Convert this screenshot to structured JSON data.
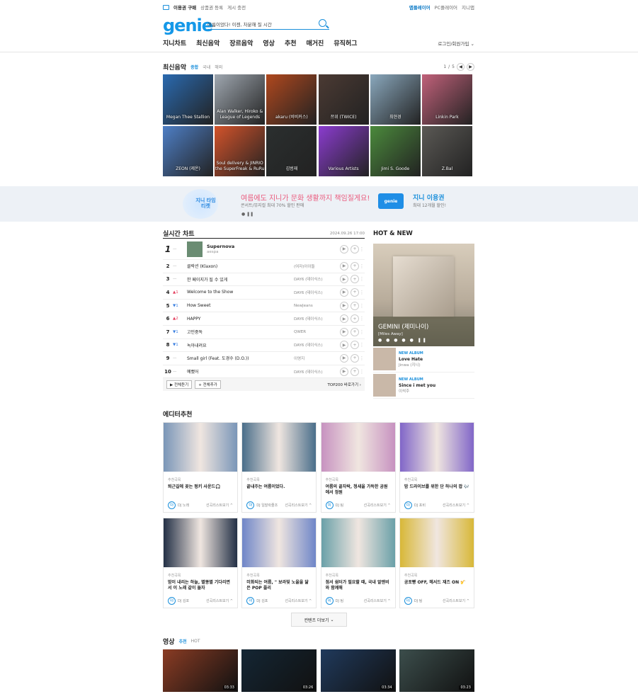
{
  "util": {
    "buy": "이용권 구매",
    "gift": "상품권 등록",
    "notice": "게시 충전",
    "player": "앱플레이어",
    "pc_player": "PC플레이어",
    "mypage": "지니앱"
  },
  "logo": "genie",
  "search": {
    "value": "여름이었다! 이젠, 차분해 질 시간"
  },
  "gnb": {
    "items": [
      "지니차트",
      "최신음악",
      "장르음악",
      "영상",
      "추천",
      "매거진",
      "뮤직허그"
    ],
    "login": "로그인/회원가입"
  },
  "newmusic": {
    "title": "최신음악",
    "tabs": [
      "종합",
      "국내",
      "해외"
    ],
    "page": "1",
    "total": "5"
  },
  "albums": [
    {
      "label": "Megan Thee Stallion",
      "color": "#2a6ab0"
    },
    {
      "label": "Alan Walker, Hiroko & League of Legends",
      "color": "#9fa7b0"
    },
    {
      "label": "akaru (비비커스)",
      "color": "#b0481e"
    },
    {
      "label": "쯔위 (TWICE)",
      "color": "#4b3a33"
    },
    {
      "label": "최현경",
      "color": "#8aa8bd"
    },
    {
      "label": "Linkin Park",
      "color": "#c1617a"
    },
    {
      "label": "ZEON (제온)",
      "color": "#4e7fc6"
    },
    {
      "label": "Soul delivery & JINRIO the SuperFreak & RuRu",
      "color": "#d3532b"
    },
    {
      "label": "김범재",
      "color": "#2b2f2f"
    },
    {
      "label": "Various Artists",
      "color": "#8b3ccf"
    },
    {
      "label": "Jimi S. Goode",
      "color": "#4b8a3c"
    },
    {
      "label": "Z.Bal",
      "color": "#5b5955"
    }
  ],
  "banner": {
    "title": "여름에도 지니가 문화 생활까지 책임질게요!",
    "sub": "콘서트/뮤지컬 최대 70% 할인 판매",
    "ticket": "지니 타임 티켓",
    "card": "genie",
    "title2": "지니 이용권",
    "sub2": "최대 12개월 할인!"
  },
  "chart": {
    "title": "실시간 차트",
    "date": "2024.09.26 17:00",
    "rows": [
      {
        "rank": "1",
        "chg": "—",
        "dir": "",
        "song": "Supernova",
        "artist": "aespa"
      },
      {
        "rank": "2",
        "chg": "—",
        "dir": "",
        "song": "클락션 (Klaxon)",
        "artist": "(여자)아이들"
      },
      {
        "rank": "3",
        "chg": "—",
        "dir": "",
        "song": "한 페이지가 될 수 있게",
        "artist": "DAY6 (데이식스)"
      },
      {
        "rank": "4",
        "chg": "▲1",
        "dir": "up",
        "song": "Welcome to the Show",
        "artist": "DAY6 (데이식스)"
      },
      {
        "rank": "5",
        "chg": "▼1",
        "dir": "dn",
        "song": "How Sweet",
        "artist": "NewJeans"
      },
      {
        "rank": "6",
        "chg": "▲2",
        "dir": "up",
        "song": "HAPPY",
        "artist": "DAY6 (데이식스)"
      },
      {
        "rank": "7",
        "chg": "▼1",
        "dir": "dn",
        "song": "고민중독",
        "artist": "QWER"
      },
      {
        "rank": "8",
        "chg": "▼1",
        "dir": "dn",
        "song": "녹아내려요",
        "artist": "DAY6 (데이식스)"
      },
      {
        "rank": "9",
        "chg": "—",
        "dir": "",
        "song": "Small girl (Feat. 도경수 (D.O.))",
        "artist": "이영지"
      },
      {
        "rank": "10",
        "chg": "—",
        "dir": "",
        "song": "예뻤어",
        "artist": "DAY6 (데이식스)"
      }
    ],
    "listen": "전체듣기",
    "add": "전체추가",
    "top200": "TOP200 바로가기"
  },
  "hot": {
    "title": "HOT & NEW",
    "feature_name": "GEMINI (제미나이)",
    "feature_sub": "[Miles Away]",
    "dots": "● ● ● ● ● ❚❚",
    "items": [
      {
        "tag": "NEW ALBUM",
        "name": "Love Hate",
        "artist": "Jinwa (지니)"
      },
      {
        "tag": "NEW ALBUM",
        "name": "Since i met you",
        "artist": "이석주"
      }
    ]
  },
  "editor": {
    "title": "에디터추천",
    "cards": [
      {
        "cat": "추천곡목",
        "text": "퇴근길에 꽂는 펑키 사운드🎧",
        "dj": "DJ 노래",
        "color": "#7a96b8",
        "link": "선곡리스트보기 ^"
      },
      {
        "cat": "추천곡목",
        "text": "끝내주는 여름이었다.",
        "dj": "DJ 일말락줄조",
        "color": "#4a6e8a",
        "link": "선곡리스트보기 ^"
      },
      {
        "cat": "추천곡목",
        "text": "여름의 끝자락, 청새을 가득한 공원에서 정원",
        "dj": "DJ 팀",
        "color": "#c792c0",
        "link": "선곡리스트보기 ^"
      },
      {
        "cat": "추천곡목",
        "text": "밤 드라이브를 위한 단 하나의 팝 🎶",
        "dj": "DJ 포비",
        "color": "#8166c8",
        "link": "선곡리스트보기 ^"
      },
      {
        "cat": "추천곡목",
        "text": "밤이 내리는 하늘, 별똥별 기다리면서 이 노래 같이 들자",
        "dj": "DJ 김포",
        "color": "#233046",
        "link": "선곡리스트보기 ^"
      },
      {
        "cat": "추천곡목",
        "text": "미화되는 여름, \" 보라빛 노을을 닮은 POP 플리",
        "dj": "DJ 김포",
        "color": "#6f86c8",
        "link": "선곡리스트보기 ^"
      },
      {
        "cat": "추천곡목",
        "text": "점서 쉼터가 필요할 때, 국내 알앤비와 함께해",
        "dj": "DJ 팀",
        "color": "#6aa0a8",
        "link": "선곡리스트보기 ^"
      },
      {
        "cat": "추천곡목",
        "text": "공포빵 OFF, 헤서드 재즈 ON 🎷",
        "dj": "DJ 팀",
        "color": "#d8b838",
        "link": "선곡리스트보기 ^"
      }
    ],
    "more": "컨텐츠 더보기"
  },
  "video": {
    "title": "영상",
    "tabs": [
      "추천",
      "HOT"
    ],
    "items": [
      {
        "time": "03:33",
        "color": "#8a3c24"
      },
      {
        "time": "03:26",
        "color": "#142634"
      },
      {
        "time": "03:34",
        "color": "#203a5c"
      },
      {
        "time": "03:23",
        "color": "#3c4e4c"
      }
    ]
  }
}
